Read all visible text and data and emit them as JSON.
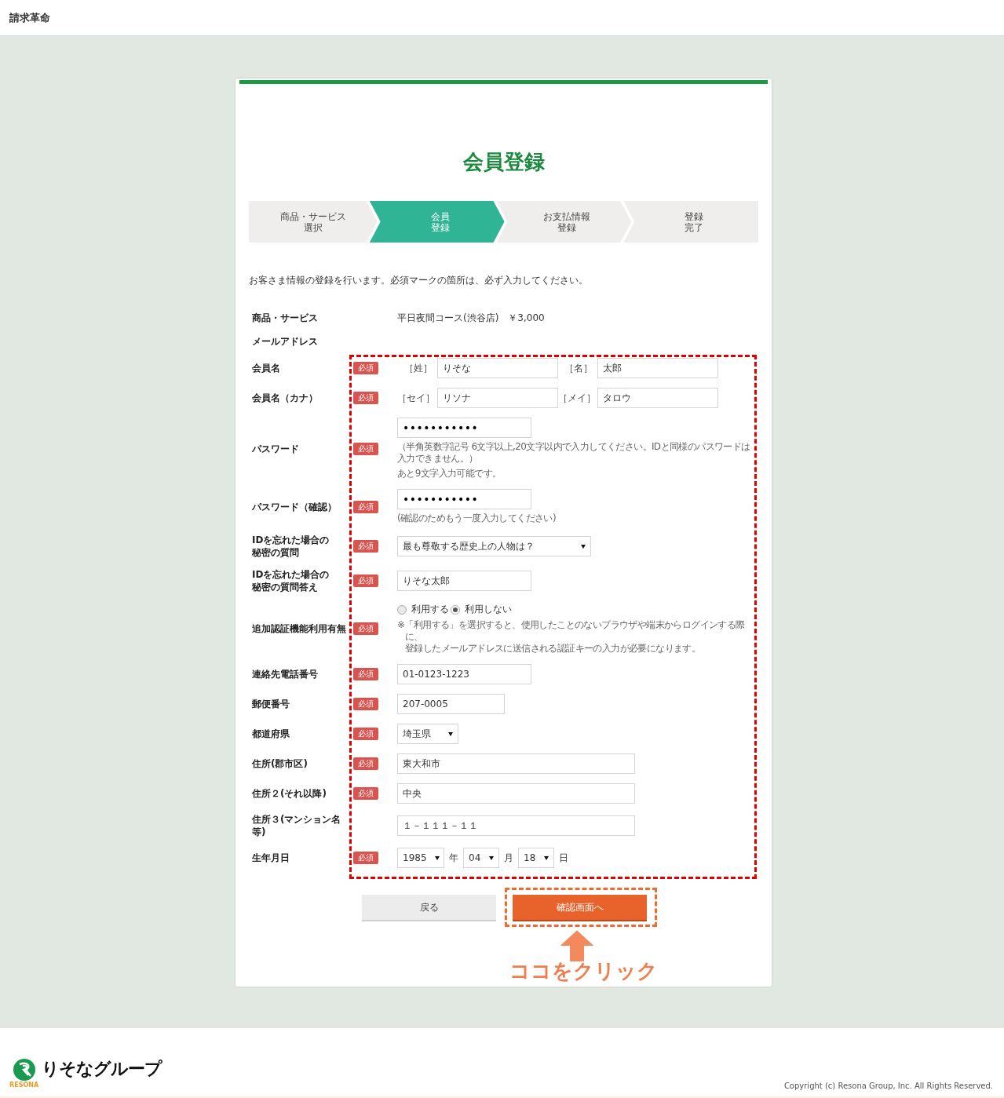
{
  "header": {
    "title": "請求革命"
  },
  "page": {
    "title": "会員登録"
  },
  "steps": [
    {
      "lines": [
        "商品・サービス",
        "選択"
      ],
      "selected": false
    },
    {
      "lines": [
        "会員",
        "登録"
      ],
      "selected": true
    },
    {
      "lines": [
        "お支払情報",
        "登録"
      ],
      "selected": false
    },
    {
      "lines": [
        "登録",
        "完了"
      ],
      "selected": false
    }
  ],
  "intro": "お客さま情報の登録を行います。必須マークの箇所は、必ず入力してください。",
  "summary": [
    {
      "label": "商品・サービス",
      "value": "平日夜間コース(渋谷店)　￥3,000"
    },
    {
      "label": "メールアドレス"
    }
  ],
  "fields": [
    {
      "kind": "name",
      "label": [
        "会員名"
      ],
      "badge": "必須",
      "parts": [
        {
          "prefix": "［姓］",
          "value": "りそな"
        },
        {
          "prefix": "［名］",
          "value": "太郎"
        }
      ]
    },
    {
      "kind": "name",
      "label": [
        "会員名（カナ）"
      ],
      "badge": "必須",
      "parts": [
        {
          "prefix": "［セイ］",
          "value": "リソナ"
        },
        {
          "prefix": "［メイ］",
          "value": "タロウ"
        }
      ]
    },
    {
      "kind": "password",
      "label": [
        "パスワード"
      ],
      "badge": "必須",
      "value": "•••••••••••",
      "notes": [
        "（半角英数字記号 6文字以上,20文字以内で入力してください。IDと同様のパスワードは入力できません。）",
        "あと9文字入力可能です。"
      ]
    },
    {
      "kind": "password",
      "label": [
        "パスワード（確認）"
      ],
      "badge": "必須",
      "value": "•••••••••••",
      "notes": [
        "(確認のためもう一度入力してください)"
      ]
    },
    {
      "kind": "select",
      "label": [
        "IDを忘れた場合の",
        "秘密の質問"
      ],
      "badge": "必須",
      "value": "最も尊敬する歴史上の人物は？"
    },
    {
      "kind": "text",
      "label": [
        "IDを忘れた場合の",
        "秘密の質問答え"
      ],
      "badge": "必須",
      "value": "りそな太郎"
    },
    {
      "kind": "radio",
      "label": [
        "追加認証機能利用有無"
      ],
      "badge": "必須",
      "options": [
        {
          "label": "利用する",
          "selected": false
        },
        {
          "label": "利用しない",
          "selected": true
        }
      ],
      "note": [
        "※「利用する」を選択すると、使用したことのないブラウザや端末からログインする際に、",
        "登録したメールアドレスに送信される認証キーの入力が必要になります。"
      ]
    },
    {
      "kind": "text",
      "label": [
        "連絡先電話番号"
      ],
      "badge": "必須",
      "value": "01-0123-1223"
    },
    {
      "kind": "text",
      "label": [
        "郵便番号"
      ],
      "badge": "必須",
      "value": "207-0005"
    },
    {
      "kind": "select",
      "label": [
        "都道府県"
      ],
      "badge": "必須",
      "value": "埼玉県"
    },
    {
      "kind": "text",
      "label": [
        "住所(郡市区)"
      ],
      "badge": "必須",
      "value": "東大和市"
    },
    {
      "kind": "text",
      "label": [
        "住所２(それ以降)"
      ],
      "badge": "必須",
      "value": "中央"
    },
    {
      "kind": "text",
      "label": [
        "住所３(マンション名等)"
      ],
      "value": "１－１１１－１１"
    },
    {
      "kind": "date",
      "label": [
        "生年月日"
      ],
      "badge": "必須",
      "parts": [
        {
          "value": "1985",
          "unit": "年"
        },
        {
          "value": "04",
          "unit": "月"
        },
        {
          "value": "18",
          "unit": "日"
        }
      ]
    }
  ],
  "buttons": [
    {
      "label": "戻る",
      "kind": "secondary"
    },
    {
      "label": "確認画面へ",
      "kind": "primary"
    }
  ],
  "annotation": {
    "label": "ココをクリック"
  },
  "footer": {
    "logo_text": "りそなグループ",
    "logo_sub": "RESONA",
    "copyright": "Copyright (c) Resona Group, Inc. All Rights Reserved."
  }
}
